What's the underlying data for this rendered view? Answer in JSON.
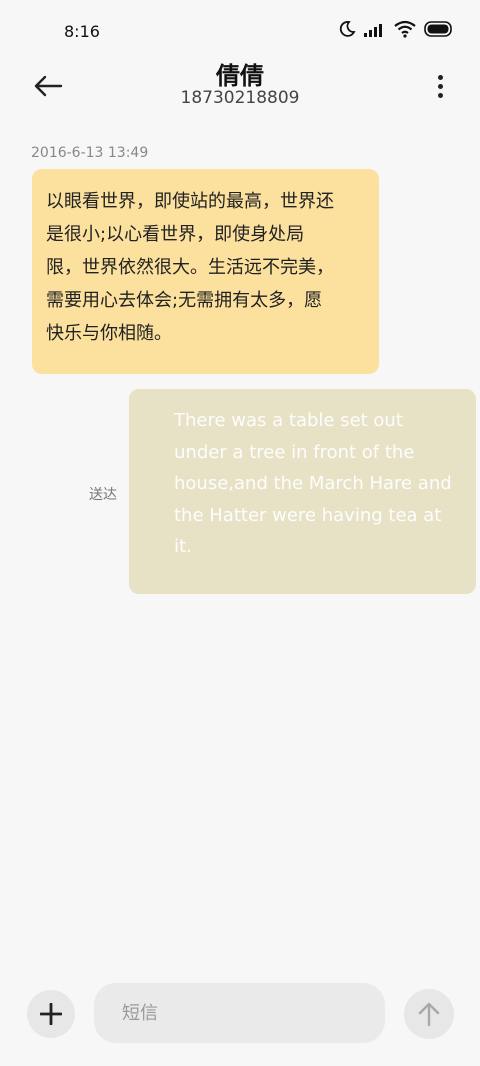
{
  "status_bar": {
    "time": "8:16",
    "icons": [
      "moon-icon",
      "signal-icon",
      "wifi-icon",
      "battery-icon"
    ]
  },
  "header": {
    "contact_name": "倩倩",
    "phone_number": "18730218809",
    "back_icon": "back-arrow-icon",
    "more_icon": "more-vertical-icon"
  },
  "conversation": {
    "timestamp": "2016-6-13 13:49",
    "incoming_message": "以眼看世界，即使站的最高，世界还是很小;以心看世界，即使身处局限，世界依然很大。生活远不完美，需要用心去体会;无需拥有太多，愿快乐与你相随。",
    "outgoing_message": "There was a table set out under a tree in front of the house,and the March Hare and the Hatter were having tea at it.",
    "outgoing_status": "送达"
  },
  "composer": {
    "placeholder": "短信",
    "value": "",
    "add_icon": "plus-icon",
    "send_icon": "arrow-up-icon"
  },
  "colors": {
    "background": "#f7f7f7",
    "incoming_bubble": "#fbe09e",
    "outgoing_bubble": "#e7e2c5",
    "button_bg": "#e7e7e7"
  }
}
